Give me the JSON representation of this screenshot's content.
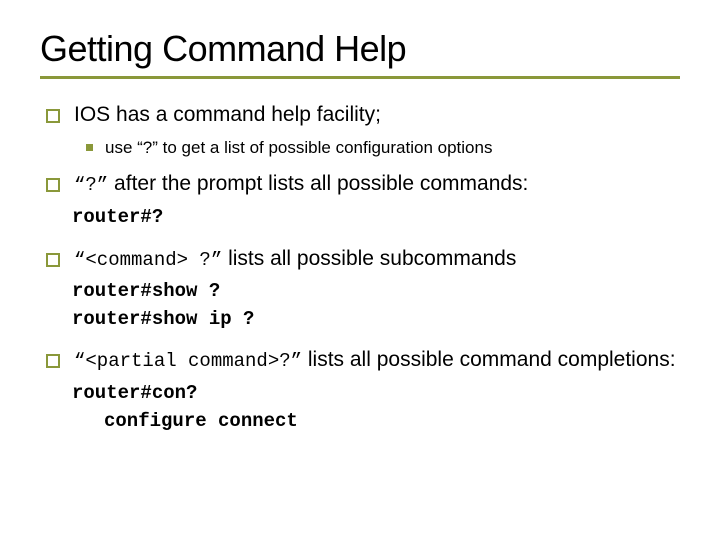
{
  "title": "Getting Command Help",
  "b1": "IOS has a command help facility;",
  "b1sub": "use “?” to get a list of possible configuration options",
  "b2pre": "“?”",
  "b2post": " after the prompt lists all possible commands:",
  "b2code": "router#?",
  "b3pre": "“<command> ?”",
  "b3post": " lists all possible subcommands",
  "b3code1": "router#show ?",
  "b3code2": "router#show ip ?",
  "b4pre": "“<partial command>?”",
  "b4post": " lists all possible command completions:",
  "b4code1": "router#con?",
  "b4code2": "configure  connect"
}
